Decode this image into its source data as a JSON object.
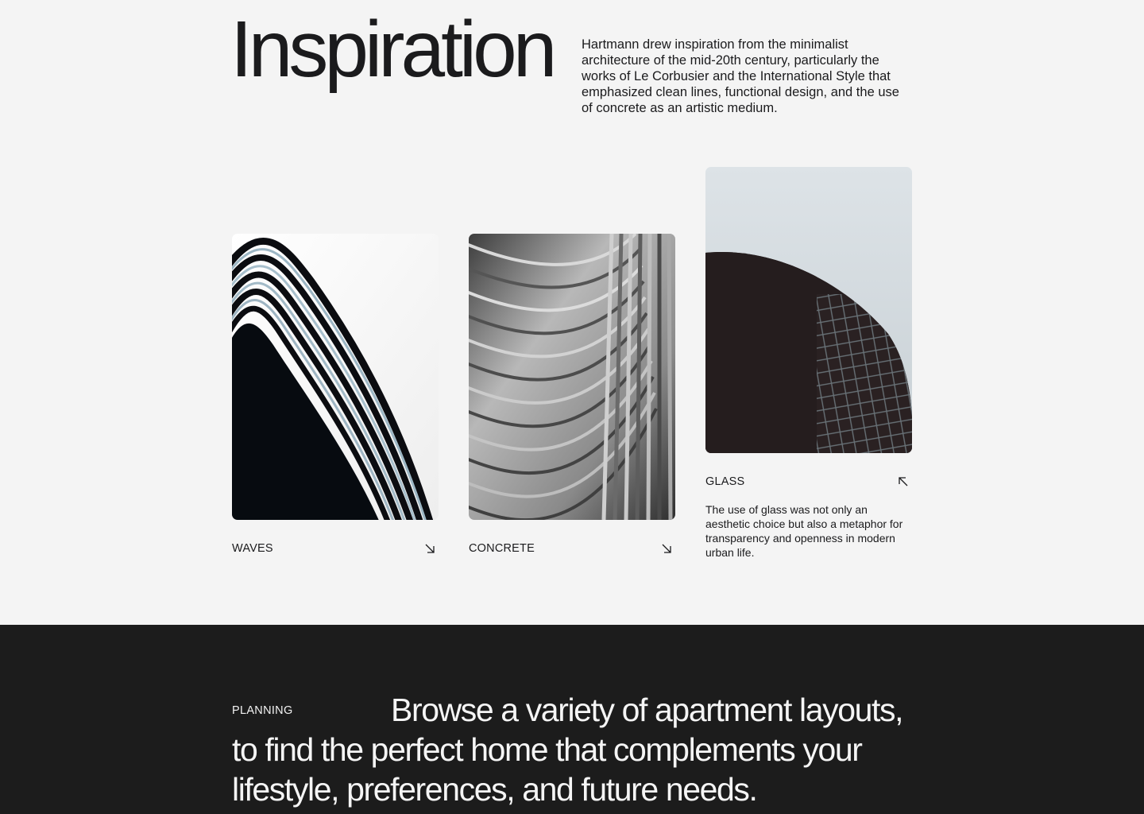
{
  "inspiration": {
    "title": "Inspiration",
    "description": "Hartmann drew inspiration from the minimalist architecture of the mid-20th century, particularly the works of Le Corbusier and the International Style that emphasized clean lines, functional design, and the use of concrete as an artistic medium."
  },
  "cards": [
    {
      "label": "WAVES",
      "arrow_icon": "arrow-down-right-icon",
      "image": "wavy-striped-building-photo"
    },
    {
      "label": "CONCRETE",
      "arrow_icon": "arrow-down-right-icon",
      "image": "curved-concrete-ribs-photo"
    },
    {
      "label": "GLASS",
      "arrow_icon": "arrow-up-left-icon",
      "image": "lattice-dome-photo",
      "description": "The use of glass was not only an aesthetic choice but also a metaphor for transparency and openness in modern urban life."
    }
  ],
  "planning": {
    "label": "PLANNING",
    "text": "Browse a variety of apartment layouts, to find the perfect home that complements your lifestyle, preferences, and future needs."
  },
  "colors": {
    "background": "#f4f4f4",
    "text": "#1b1b1d",
    "dark_section": "#1c1c1c",
    "dark_text": "#f5f5f5"
  }
}
